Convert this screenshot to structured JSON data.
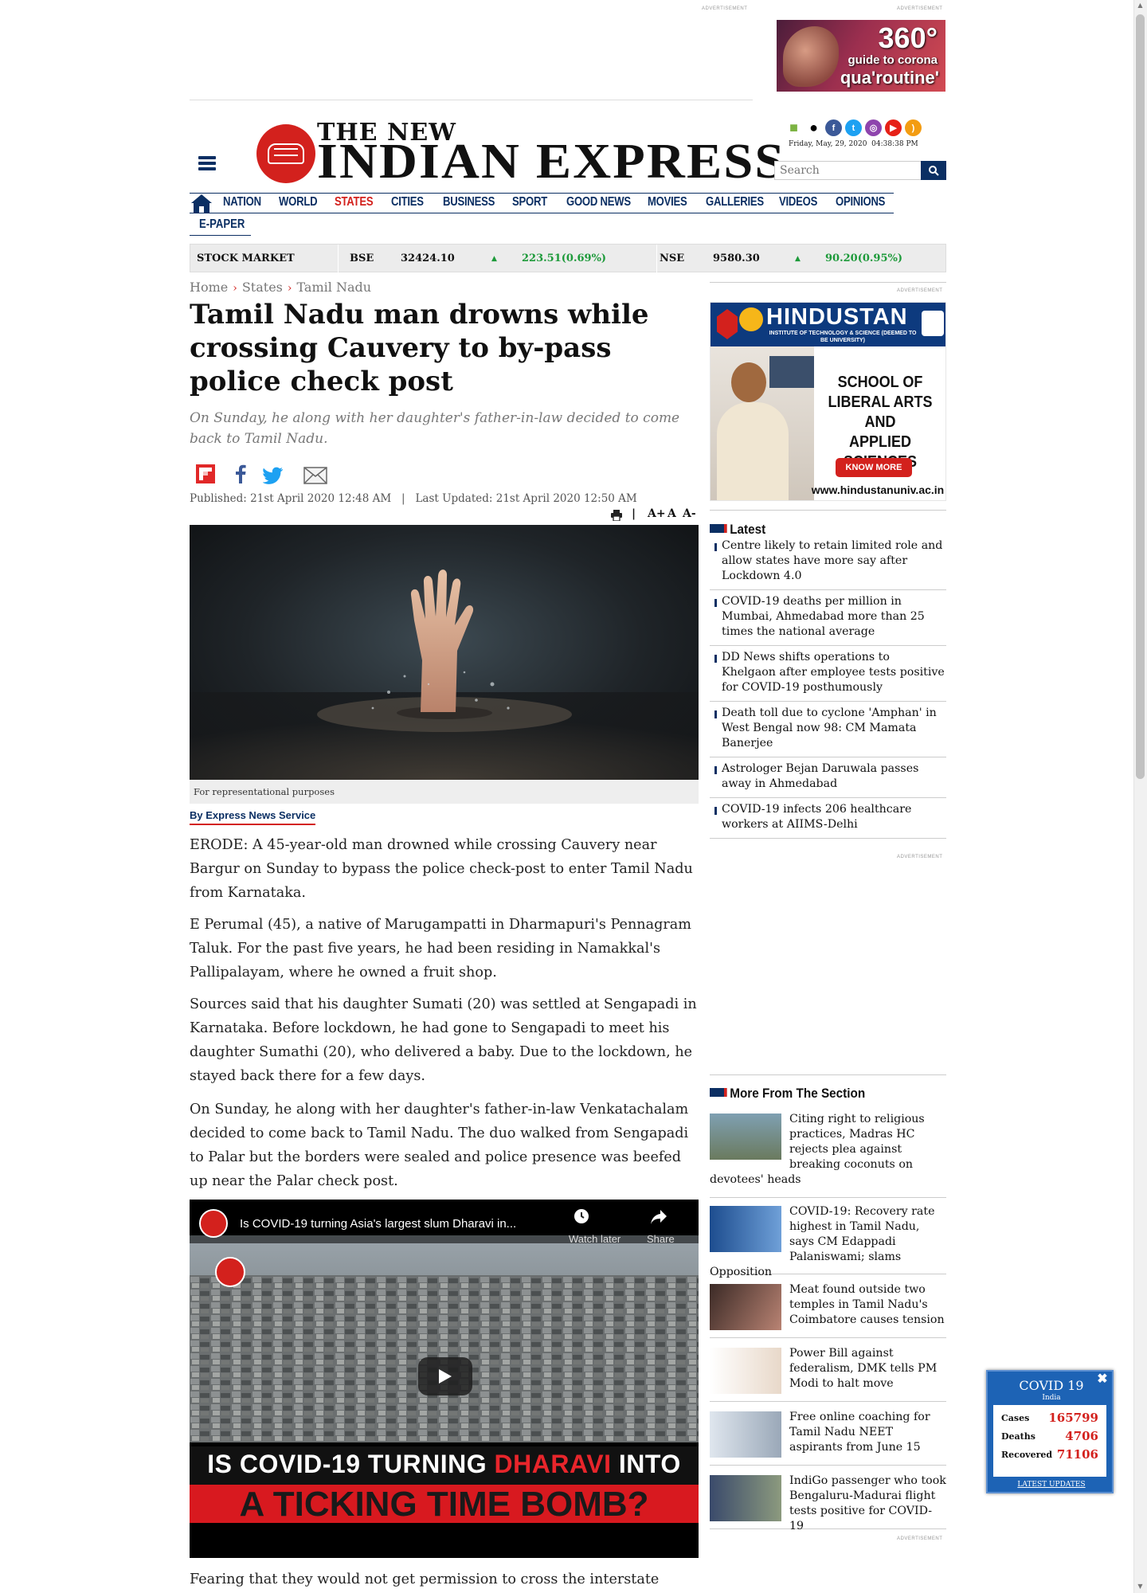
{
  "ads": {
    "advertisement_label": "ADVERTISEMENT",
    "corona_ad": {
      "line1": "360°",
      "line2": "guide to corona",
      "line3": "qua'routine'"
    },
    "hindustan_ad": {
      "brand": "HINDUSTAN",
      "subtitle": "INSTITUTE OF TECHNOLOGY & SCIENCE (DEEMED TO BE UNIVERSITY)",
      "school": [
        "SCHOOL OF",
        "LIBERAL ARTS",
        "AND",
        "APPLIED SCIENCES"
      ],
      "cta": "KNOW MORE",
      "url": "www.hindustanuniv.ac.in"
    }
  },
  "header": {
    "logo_top": "THE NEW",
    "logo_main": "INDIAN EXPRESS",
    "date": "Friday, May, 29, 2020",
    "time": "04:38:38 PM",
    "search_placeholder": "Search",
    "app_icons": [
      "android-icon",
      "apple-icon",
      "facebook-icon",
      "twitter-icon",
      "instagram-icon",
      "youtube-icon",
      "rss-icon"
    ]
  },
  "nav": {
    "items": [
      "NATION",
      "WORLD",
      "STATES",
      "CITIES",
      "BUSINESS",
      "SPORT",
      "GOOD NEWS",
      "MOVIES",
      "GALLERIES",
      "VIDEOS",
      "OPINIONS"
    ],
    "active": "STATES",
    "epaper": "E-PAPER"
  },
  "stock": {
    "label": "STOCK MARKET",
    "bse_label": "BSE",
    "bse_value": "32424.10",
    "bse_change": "223.51(0.69%)",
    "nse_label": "NSE",
    "nse_value": "9580.30",
    "nse_change": "90.20(0.95%)",
    "up_color": "#1d9a3a"
  },
  "breadcrumb": [
    "Home",
    "States",
    "Tamil Nadu"
  ],
  "article": {
    "headline": "Tamil Nadu man drowns while crossing Cauvery to by-pass police check post",
    "summary": "On Sunday, he along with her daughter's father-in-law decided to come back to Tamil Nadu.",
    "published": "Published: 21st April 2020 12:48 AM",
    "updated": "Last Updated: 21st April 2020 12:50 AM",
    "font_tools": [
      "A+",
      "A",
      "A-"
    ],
    "image_caption": "For representational purposes",
    "byline": "By Express News Service",
    "paragraphs": [
      "ERODE: A 45-year-old man drowned while crossing Cauvery near Bargur on Sunday to bypass the police check-post to enter Tamil Nadu from Karnataka.",
      "E Perumal (45), a native of Marugampatti in Dharmapuri's Pennagram Taluk. For the past five years, he had been residing in Namakkal's Pallipalayam, where he owned a fruit shop.",
      "Sources said that his daughter Sumati (20) was settled at Sengapadi in Karnataka. Before lockdown, he had gone to Sengapadi to meet his daughter Sumathi (20), who delivered a baby. Due to the lockdown, he stayed back there for a few days.",
      "On Sunday, he along with her daughter's father-in-law Venkatachalam decided to come back to Tamil Nadu. The duo walked from Sengapadi to Palar but the borders were sealed and police presence was beefed up near the Palar check post.",
      "Fearing that they would not get permission to cross the interstate"
    ]
  },
  "video": {
    "title": "Is COVID-19 turning Asia's largest slum Dharavi in...",
    "watch_later": "Watch later",
    "share": "Share",
    "banner_line1_a": "IS COVID-19 TURNING ",
    "banner_line1_b": "DHARAVI",
    "banner_line1_c": " INTO",
    "banner_line2": "A TICKING TIME BOMB?"
  },
  "sidebar": {
    "latest_title": "Latest",
    "latest": [
      "Centre likely to retain limited role and allow states have more say after Lockdown 4.0",
      "COVID-19 deaths per million in Mumbai, Ahmedabad more than 25 times the national average",
      "DD News shifts operations to Khelgaon after employee tests positive for COVID-19 posthumously",
      "Death toll due to cyclone 'Amphan' in West Bengal now 98: CM Mamata Banerjee",
      "Astrologer Bejan Daruwala passes away in Ahmedabad",
      "COVID-19 infects 206 healthcare workers at AIIMS-Delhi"
    ],
    "more_title": "More From The Section",
    "more": [
      "Citing right to religious practices, Madras HC rejects plea against breaking coconuts on devotees' heads",
      "COVID-19: Recovery rate highest in Tamil Nadu, says CM Edappadi Palaniswami; slams Opposition",
      "Meat found outside two temples in Tamil Nadu's Coimbatore causes tension",
      "Power Bill against federalism, DMK tells PM Modi to halt move",
      "Free online coaching for Tamil Nadu NEET aspirants from June 15",
      "IndiGo passenger who took Bengaluru-Madurai flight tests positive for COVID-19"
    ]
  },
  "covid_widget": {
    "title": "COVID 19",
    "country": "India",
    "cases_label": "Cases",
    "cases": "165799",
    "deaths_label": "Deaths",
    "deaths": "4706",
    "recovered_label": "Recovered",
    "recovered": "71106",
    "link": "LATEST UPDATES"
  },
  "colors": {
    "brand_navy": "#0b2f63",
    "brand_red": "#d3211d"
  }
}
